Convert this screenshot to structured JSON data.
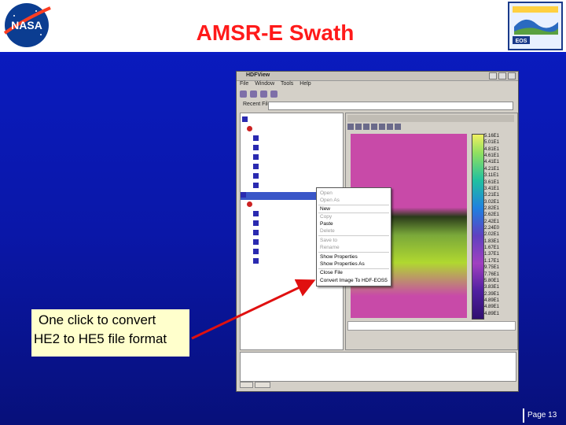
{
  "slide": {
    "title": "AMSR-E Swath",
    "page_label": "Page 13",
    "callout_line1": "One click to convert",
    "callout_line2": "HE2 to HE5 file format"
  },
  "logos": {
    "left": "NASA",
    "right": "EOS"
  },
  "window": {
    "title": "HDFView",
    "menu": [
      "File",
      "Window",
      "Tools",
      "Help"
    ],
    "path_label": "Recent Files"
  },
  "context_menu": {
    "items": [
      "Open",
      "Open As",
      "New",
      "Copy",
      "Paste",
      "Delete",
      "Save to",
      "Rename",
      "Show Properties",
      "Show Properties As",
      "Close File",
      "Convert Image To HDF-EOS5"
    ]
  },
  "colorbar_labels": [
    "5.16E1",
    "5.01E1",
    "4.81E1",
    "4.61E1",
    "4.41E1",
    "4.21E1",
    "3.11E1",
    "3.61E1",
    "3.41E1",
    "3.21E1",
    "3.02E1",
    "2.82E1",
    "2.62E1",
    "2.42E1",
    "2.24E0",
    "2.02E1",
    "1.83E1",
    "1.67E1",
    "1.37E1",
    "1.17E1",
    "9.75E1",
    "7.76E1",
    "5.80E1",
    "3.83E1",
    "2.39E1",
    "4.89E1",
    "4.89E1",
    "4.89E1"
  ],
  "colors": {
    "background": "#0a1cc4",
    "title": "#ff1a1a",
    "callout_bg": "#ffffcc",
    "arrow": "#e01010"
  }
}
